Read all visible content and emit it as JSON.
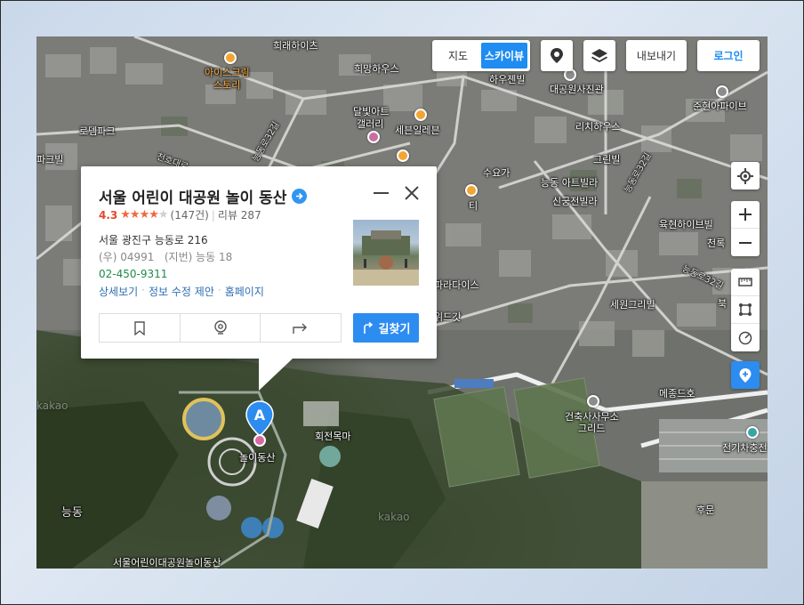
{
  "map": {
    "mode_toggle": {
      "options": [
        "지도",
        "스카이뷰"
      ],
      "active": "스카이뷰"
    },
    "export_label": "내보내기",
    "login_label": "로그인",
    "labels": {
      "hoerae_heights": "희래하이츠",
      "icecream_1": "아이스크림",
      "icecream_2": "스토리",
      "huimang_house": "희망하우스",
      "heuje_bill": "하우젠빌",
      "daegongwon_photo": "대공원사진관",
      "junhyeon_apt": "준현아파이브",
      "lodem_park": "로뎀파크",
      "dalbit_art_1": "달빛아트",
      "dalbit_art_2": "갤러리",
      "seven_eleven": "세븐일레븐",
      "richi_house": "리치하우스",
      "park_bill": "파크빌",
      "suyoga": "수요가",
      "green_bill": "그린빌",
      "neungdong_art": "능동 아트빌라",
      "singung_villa": "신궁전빌라",
      "tea": "티",
      "yukhyeon_bill": "육현하이브빌",
      "cheongrok": "천록",
      "road_neungdong32": "능동로32길",
      "road_neungdong32_b": "능동로32길",
      "road_32": "능동로32길",
      "road_cheondong": "천호대로",
      "paradise": "파라다이스",
      "widgat": "위드갓",
      "sewon": "세원그리빌",
      "buk": "북",
      "mejong": "메종드호",
      "geonchuk_1": "건축사사무소",
      "geonchuk_2": "그리드",
      "hoejeon_mokma": "회전목마",
      "neungdong_area": "능동",
      "electric_charge": "전기차충전",
      "hubun": "후문",
      "bottom_label": "서울어린이대공원놀이동산",
      "kakao_1": "kakao",
      "kakao_2": "kakao"
    },
    "marker": {
      "letter": "A",
      "label": "놀이동산"
    }
  },
  "place": {
    "name": "서울 어린이 대공원 놀이 동산",
    "rating": "4.3",
    "stars_filled": 4.3,
    "review_count": "(147건)",
    "review_label": "리뷰 287",
    "address": "서울 광진구 능동로 216",
    "zip": "(우) 04991",
    "jibun": "(지번) 능동 18",
    "phone": "02-450-9311",
    "links": [
      "상세보기",
      "정보 수정 제안",
      "홈페이지"
    ],
    "route_label": "길찾기"
  },
  "colors": {
    "accent": "#1e8cf0",
    "star": "#f06940",
    "phone": "#1f8a4c",
    "link": "#2f6fb3"
  }
}
